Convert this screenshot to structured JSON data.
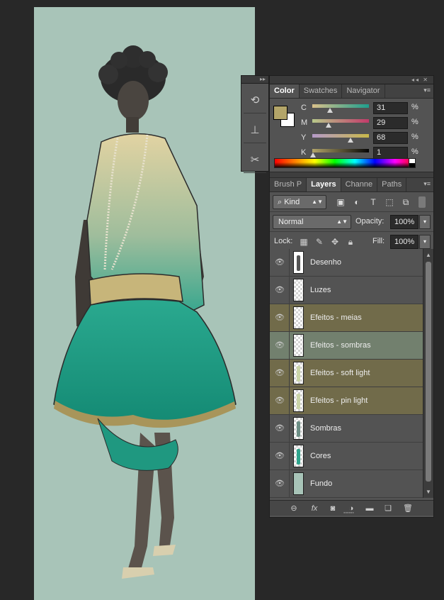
{
  "colors": {
    "foreground": "#b3a569",
    "background": "#ffffff",
    "canvas": "#a8c4b8",
    "layer_highlight": "#716b4a",
    "layer_selected": "#72806e"
  },
  "color_panel": {
    "tabs": [
      {
        "label": "Color",
        "active": true
      },
      {
        "label": "Swatches",
        "active": false
      },
      {
        "label": "Navigator",
        "active": false
      }
    ],
    "sliders": [
      {
        "label": "C",
        "value": "31",
        "unit": "%",
        "fraction": 0.31,
        "gradient": "linear-gradient(to right,#d9c08a,#1e9e8c)"
      },
      {
        "label": "M",
        "value": "29",
        "unit": "%",
        "fraction": 0.29,
        "gradient": "linear-gradient(to right,#b8c98a,#c23a6a)"
      },
      {
        "label": "Y",
        "value": "68",
        "unit": "%",
        "fraction": 0.68,
        "gradient": "linear-gradient(to right,#b59ac8,#c8b84a)"
      },
      {
        "label": "K",
        "value": "1",
        "unit": "%",
        "fraction": 0.01,
        "gradient": "linear-gradient(to right,#b3a569,#050505)"
      }
    ]
  },
  "layers_panel": {
    "tabs": [
      {
        "label": "Brush P",
        "active": false
      },
      {
        "label": "Layers",
        "active": true
      },
      {
        "label": "Channe",
        "active": false
      },
      {
        "label": "Paths",
        "active": false
      }
    ],
    "filter_kind": "Kind",
    "filter_icons": [
      "image-filter-icon",
      "adjustment-filter-icon",
      "type-filter-icon",
      "shape-filter-icon",
      "smart-object-filter-icon"
    ],
    "blend_mode": "Normal",
    "opacity_label": "Opacity:",
    "opacity_value": "100%",
    "lock_label": "Lock:",
    "fill_label": "Fill:",
    "fill_value": "100%",
    "layers": [
      {
        "name": "Desenho",
        "state": "normal",
        "thumb": "drawing"
      },
      {
        "name": "Luzes",
        "state": "normal",
        "thumb": "empty"
      },
      {
        "name": "Efeitos - meias",
        "state": "highlight",
        "thumb": "empty"
      },
      {
        "name": "Efeitos - sombras",
        "state": "selected",
        "thumb": "empty"
      },
      {
        "name": "Efeitos - soft light",
        "state": "highlight",
        "thumb": "figure-light"
      },
      {
        "name": "Efeitos - pin light",
        "state": "highlight",
        "thumb": "figure-light"
      },
      {
        "name": "Sombras",
        "state": "normal",
        "thumb": "figure-dark"
      },
      {
        "name": "Cores",
        "state": "normal",
        "thumb": "figure-color"
      },
      {
        "name": "Fundo",
        "state": "normal",
        "thumb": "fill"
      }
    ]
  }
}
